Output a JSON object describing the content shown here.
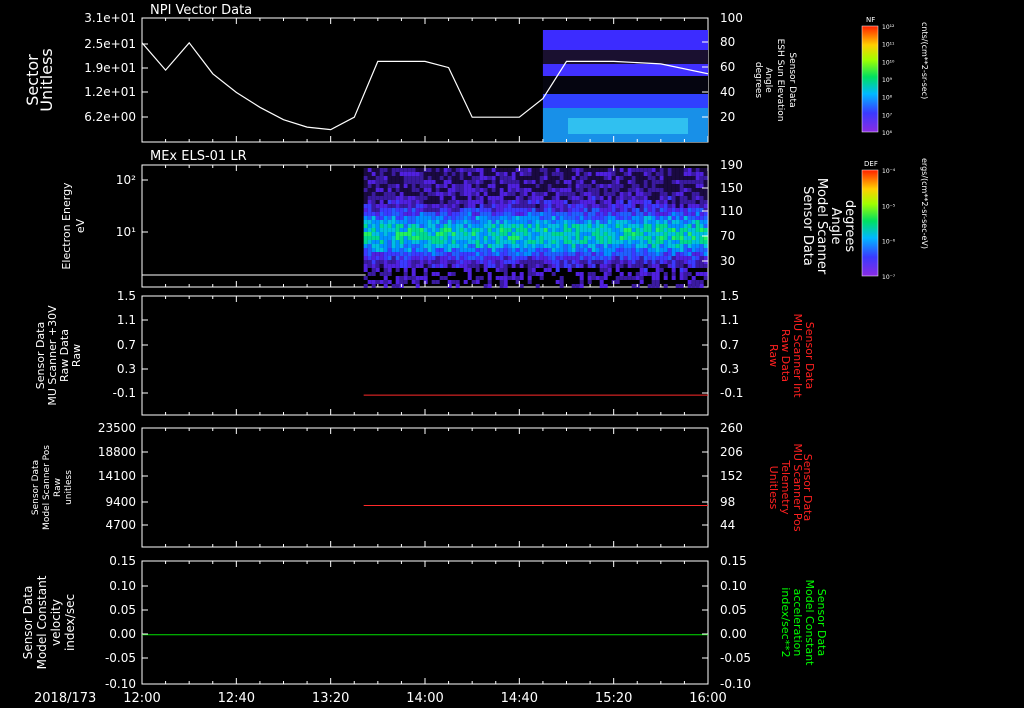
{
  "date_label": "2018/173",
  "time_ticks": [
    "12:00",
    "12:40",
    "13:20",
    "14:00",
    "14:40",
    "15:20",
    "16:00"
  ],
  "panels": [
    {
      "title": "NPI Vector Data",
      "left_label": [
        "Sector",
        "Unitless"
      ],
      "left_ticks": [
        "3.1e+01",
        "2.5e+01",
        "1.9e+01",
        "1.2e+01",
        "6.2e+00"
      ],
      "right_label": [
        "Sensor Data",
        "ESH Sun Elevation",
        "Angle",
        "degrees"
      ],
      "right_ticks": [
        "100",
        "80",
        "60",
        "40",
        "20"
      ],
      "colorbar": {
        "title": "NF",
        "units": "cnts/(cm**2-sr-sec)",
        "tick_labels": [
          "10¹²",
          "10¹¹",
          "10¹⁰",
          "10⁹",
          "10⁸",
          "10⁷",
          "10⁶"
        ]
      }
    },
    {
      "title": "MEx ELS-01 LR",
      "left_label": [
        "Electron Energy",
        "eV"
      ],
      "left_ticks": [
        "10²",
        "10¹"
      ],
      "right_label": [
        "Sensor Data",
        "Model Scanner",
        "Angle",
        "degrees"
      ],
      "right_ticks": [
        "190",
        "150",
        "110",
        "70",
        "30"
      ],
      "colorbar": {
        "title": "DEF",
        "units": "ergs/(cm**2-sr-sec-eV)",
        "tick_labels": [
          "10⁻⁴",
          "10⁻⁵",
          "10⁻⁶",
          "10⁻⁷"
        ]
      }
    },
    {
      "title": "",
      "left_label": [
        "Sensor Data",
        "MU Scanner +30V",
        "Raw Data",
        "Raw"
      ],
      "left_ticks": [
        "1.5",
        "1.1",
        "0.7",
        "0.3",
        "-0.1"
      ],
      "right_label": [
        "Sensor Data",
        "MU Scanner Int",
        "Raw Data",
        "Raw"
      ],
      "right_ticks": [
        "1.5",
        "1.1",
        "0.7",
        "0.3",
        "-0.1"
      ]
    },
    {
      "title": "",
      "left_label": [
        "Sensor Data",
        "Model Scanner Pos",
        "Raw",
        "unitless"
      ],
      "left_ticks": [
        "23500",
        "18800",
        "14100",
        "9400",
        "4700"
      ],
      "right_label": [
        "Sensor Data",
        "MU Scanner Pos",
        "Telemetry",
        "Unitless"
      ],
      "right_ticks": [
        "260",
        "206",
        "152",
        "98",
        "44"
      ]
    },
    {
      "title": "",
      "left_label": [
        "Sensor Data",
        "Model Constant",
        "velocity",
        "index/sec"
      ],
      "left_ticks": [
        "0.15",
        "0.10",
        "0.05",
        "0.00",
        "-0.05",
        "-0.10"
      ],
      "right_label": [
        "Sensor Data",
        "Model Constant",
        "acceleration",
        "index/sec**2"
      ],
      "right_ticks": [
        "0.15",
        "0.10",
        "0.05",
        "0.00",
        "-0.05",
        "-0.10"
      ]
    }
  ],
  "colors": {
    "white_line": "#ffffff",
    "red_line": "#ff2a2a",
    "green_line": "#00e000",
    "red_label": "#ff2020",
    "green_label": "#00ff00"
  },
  "chart_data": [
    {
      "type": "line",
      "panel": 1,
      "title": "NPI Vector Data",
      "x_range": [
        "12:00",
        "16:00"
      ],
      "series": [
        {
          "axis": "right",
          "ylim": [
            0,
            100
          ],
          "x": [
            "12:00",
            "12:10",
            "12:20",
            "12:30",
            "12:40",
            "12:50",
            "13:00",
            "13:10",
            "13:20",
            "13:30",
            "13:40",
            "14:00",
            "14:10",
            "14:20",
            "14:40",
            "14:50",
            "15:00",
            "15:20",
            "15:40",
            "16:00"
          ],
          "values": [
            80,
            58,
            80,
            55,
            40,
            28,
            18,
            12,
            10,
            20,
            65,
            65,
            60,
            20,
            20,
            35,
            65,
            65,
            63,
            55
          ]
        }
      ],
      "spectrogram_time_range": [
        "14:50",
        "16:00"
      ]
    },
    {
      "type": "heatmap",
      "panel": 2,
      "title": "MEx ELS-01 LR",
      "x_range": [
        "12:00",
        "16:00"
      ],
      "data_start": "13:34",
      "ylim_log_eV": [
        1,
        200
      ],
      "peak_energy_eV": 10,
      "white_line_axis": "right",
      "white_line_value": 10
    },
    {
      "type": "line",
      "panel": 3,
      "series": [
        {
          "axis": "left",
          "x": [
            "13:34",
            "16:00"
          ],
          "values": [
            0,
            0
          ],
          "ylim": [
            -0.3,
            1.5
          ]
        }
      ]
    },
    {
      "type": "line",
      "panel": 4,
      "series": [
        {
          "axis": "left",
          "x": [
            "13:34",
            "16:00"
          ],
          "values": [
            8200,
            8200
          ],
          "ylim": [
            0,
            23500
          ]
        }
      ]
    },
    {
      "type": "line",
      "panel": 5,
      "series": [
        {
          "axis": "left",
          "x": [
            "12:00",
            "16:00"
          ],
          "values": [
            0,
            0
          ],
          "ylim": [
            -0.1,
            0.15
          ]
        }
      ]
    }
  ]
}
